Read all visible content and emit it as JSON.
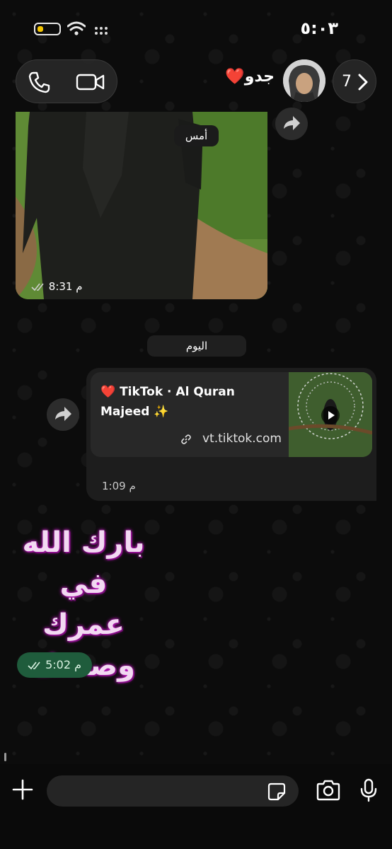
{
  "status_bar": {
    "time": "٥:٠٣",
    "battery_level": 0.3,
    "icons": [
      "battery-icon",
      "wifi-icon",
      "cellular-dots-icon"
    ],
    "battery_color": "#f3c400"
  },
  "header": {
    "contact_name": "جدو❤️",
    "back_count": "7",
    "icons": [
      "phone-icon",
      "video-icon",
      "chevron-right-icon"
    ]
  },
  "messages": {
    "photo": {
      "time": "8:31 م",
      "status": "read"
    },
    "date_yesterday": "أمس",
    "date_today": "اليوم",
    "link": {
      "title": "❤️ TikTok · Al Quran Majeed ✨",
      "domain": "vt.tiktok.com",
      "time": "1:09 م"
    },
    "sticker": {
      "lines": [
        "بارك الله",
        "في عمرك",
        "وصحتك"
      ],
      "time": "5:02 م",
      "status": "read"
    }
  },
  "input_bar": {
    "placeholder": "",
    "icons": [
      "plus-icon",
      "sticker-icon",
      "camera-icon",
      "mic-icon"
    ]
  },
  "colors": {
    "sent_bubble": "#1f5c3c",
    "received_bubble": "#1d1d1d",
    "sticker_glow": "#c71bc7"
  }
}
